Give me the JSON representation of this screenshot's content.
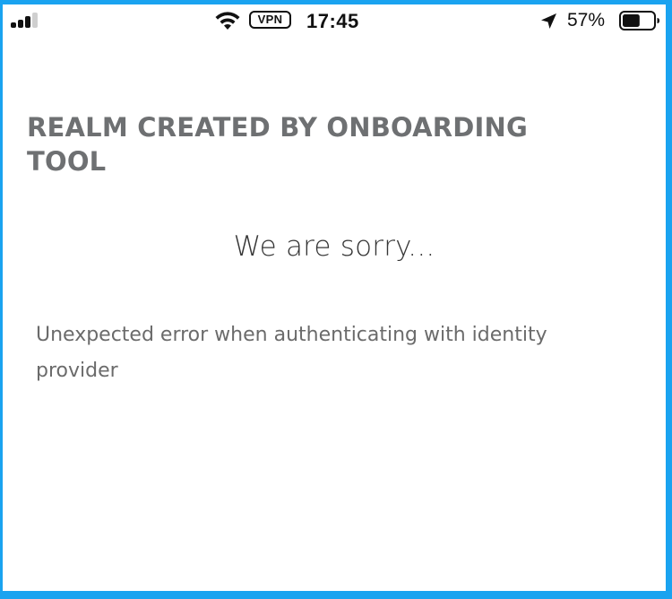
{
  "status_bar": {
    "vpn_label": "VPN",
    "time": "17:45",
    "battery_percent": "57%",
    "battery_level": 0.57,
    "signal_bars_active": 3,
    "icons": [
      "signal-icon",
      "wifi-icon",
      "location-arrow-icon",
      "battery-icon"
    ]
  },
  "page": {
    "realm_title": "REALM CREATED BY ONBOARDING TOOL",
    "sorry_heading": "We are sorry...",
    "error_message": "Unexpected error when authenticating with identity provider"
  },
  "colors": {
    "frame_border": "#1aa3f0",
    "title_text": "#6e7072",
    "heading_text": "#363636",
    "body_text": "#6b6b6b"
  }
}
